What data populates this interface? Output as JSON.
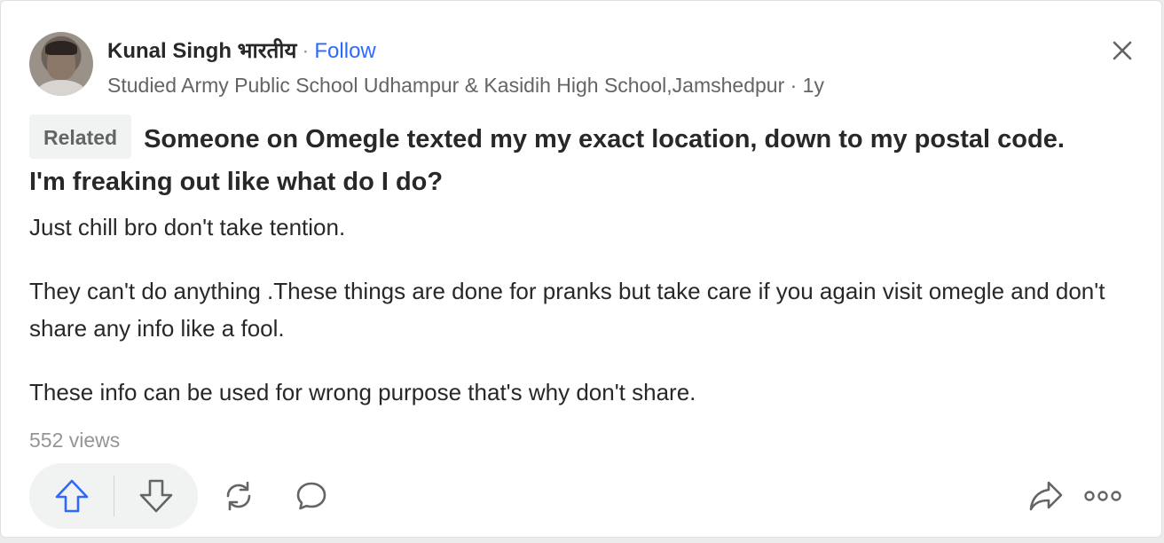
{
  "author": {
    "name": "Kunal Singh भारतीय",
    "separator": "·",
    "follow_label": "Follow",
    "credential": "Studied Army Public School Udhampur & Kasidih High School,Jamshedpur · 1y"
  },
  "question": {
    "badge": "Related",
    "text": "Someone on Omegle texted my my exact location, down to my postal code. I'm freaking out like what do I do?"
  },
  "answer": {
    "paragraphs": [
      "Just chill bro don't take tention.",
      "They can't do anything .These things are done for pranks but take care if you again visit omegle and don't share any info like a fool.",
      "These info can be used for wrong purpose that's why don't share."
    ]
  },
  "stats": {
    "views": "552 views"
  },
  "actions": {
    "icons": [
      "upvote-icon",
      "downvote-icon",
      "share-reshare-icon",
      "comment-icon",
      "share-icon",
      "more-options-icon",
      "close-icon"
    ]
  },
  "colors": {
    "accent": "#2e69ff",
    "text": "#282829",
    "muted": "#636466",
    "light_muted": "#939598",
    "pill_bg": "#f1f2f2"
  }
}
